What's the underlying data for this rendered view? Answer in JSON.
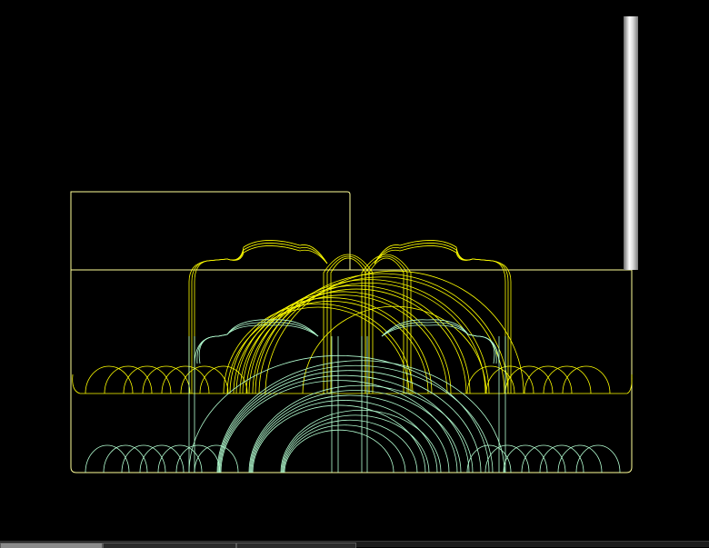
{
  "window": {
    "title": "",
    "background_color": "#000000"
  },
  "colors": {
    "toolpath_primary": "#ffff00",
    "toolpath_secondary": "#b4ffd2",
    "stock_outline": "#ffff99",
    "tool_body_light": "#ffffff",
    "tool_body_dark": "#6a6a6a"
  },
  "scene": {
    "view": "cnc-toolpath-simulation",
    "objects": [
      "stock-outline",
      "cutting-tool",
      "roughing-toolpath",
      "finishing-toolpath"
    ]
  },
  "tabs": [
    {
      "label": "",
      "active": true
    },
    {
      "label": "",
      "active": false
    },
    {
      "label": "",
      "active": false
    }
  ]
}
